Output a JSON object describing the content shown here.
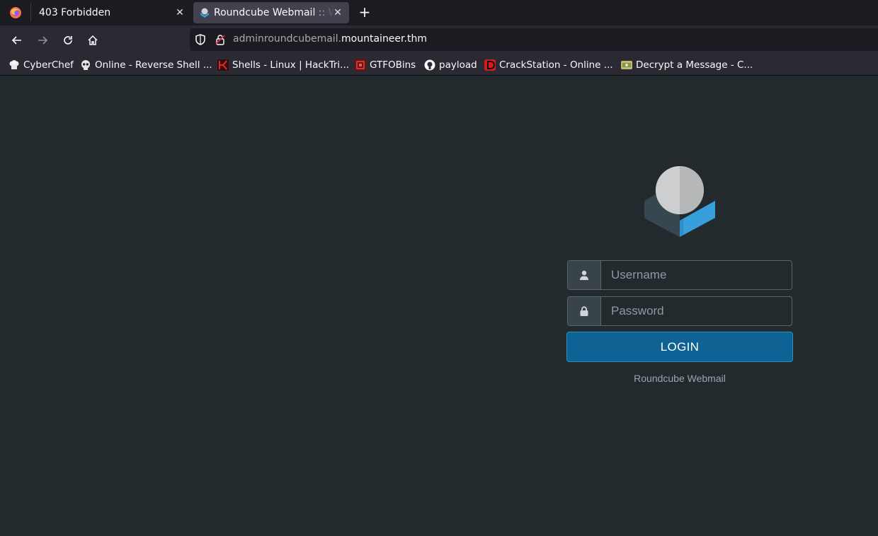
{
  "browser": {
    "tabs": [
      {
        "title": "403 Forbidden",
        "active": false
      },
      {
        "title": "Roundcube Webmail :: Welcome",
        "active": true
      }
    ],
    "url": {
      "subdomain": "adminroundcubemail.",
      "domain": "mountaineer.thm"
    },
    "bookmarks": [
      {
        "label": "CyberChef",
        "icon": "chef-hat-icon"
      },
      {
        "label": "Online - Reverse Shell ...",
        "icon": "skull-icon"
      },
      {
        "label": "Shells - Linux | HackTri...",
        "icon": "hacktricks-icon"
      },
      {
        "label": "GTFOBins",
        "icon": "gtfobins-icon"
      },
      {
        "label": "payload",
        "icon": "github-icon"
      },
      {
        "label": "CrackStation - Online ...",
        "icon": "crackstation-icon"
      },
      {
        "label": "Decrypt a Message - C...",
        "icon": "cryptii-icon"
      }
    ]
  },
  "login": {
    "username_placeholder": "Username",
    "password_placeholder": "Password",
    "button_label": "LOGIN",
    "footer": "Roundcube Webmail"
  },
  "colors": {
    "page_background": "#222a2e",
    "button": "#0e6394",
    "logo_blue": "#37a0dc",
    "logo_dark": "#37474f"
  }
}
